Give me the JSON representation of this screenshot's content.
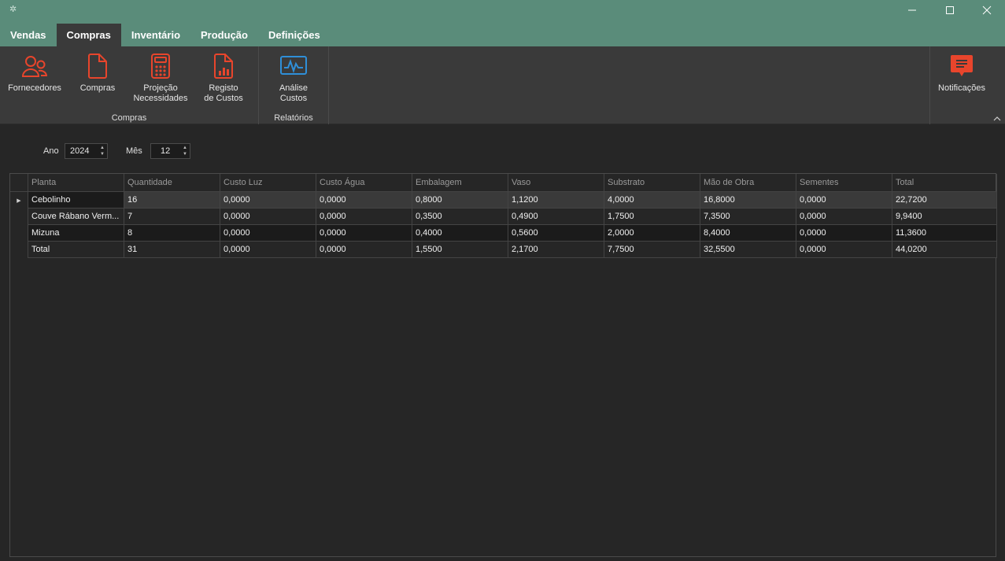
{
  "window": {
    "tabs": [
      {
        "label": "Vendas"
      },
      {
        "label": "Compras"
      },
      {
        "label": "Inventário"
      },
      {
        "label": "Produção"
      },
      {
        "label": "Definições"
      }
    ],
    "active_tab": "Compras"
  },
  "ribbon": {
    "groups": [
      {
        "label": "Compras",
        "buttons": [
          {
            "label": "Fornecedores",
            "icon": "suppliers-icon"
          },
          {
            "label": "Compras",
            "icon": "document-icon"
          },
          {
            "label": "Projeção\nNecessidades",
            "icon": "calculator-icon"
          },
          {
            "label": "Registo\nde Custos",
            "icon": "report-chart-icon"
          }
        ]
      },
      {
        "label": "Relatórios",
        "buttons": [
          {
            "label": "Análise\nCustos",
            "icon": "analytics-icon"
          }
        ]
      }
    ],
    "notifications": {
      "label": "Notificações",
      "icon": "notification-icon"
    },
    "accent_color": "#e8452c",
    "analytics_color": "#2f8fd8"
  },
  "filters": {
    "year": {
      "label": "Ano",
      "value": "2024"
    },
    "month": {
      "label": "Mês",
      "value": "12"
    }
  },
  "grid": {
    "columns": [
      "Planta",
      "Quantidade",
      "Custo Luz",
      "Custo Água",
      "Embalagem",
      "Vaso",
      "Substrato",
      "Mão de Obra",
      "Sementes",
      "Total"
    ],
    "rows": [
      [
        "Cebolinho",
        "16",
        "0,0000",
        "0,0000",
        "0,8000",
        "1,1200",
        "4,0000",
        "16,8000",
        "0,0000",
        "22,7200"
      ],
      [
        "Couve Rábano Verm...",
        "7",
        "0,0000",
        "0,0000",
        "0,3500",
        "0,4900",
        "1,7500",
        "7,3500",
        "0,0000",
        "9,9400"
      ],
      [
        "Mizuna",
        "8",
        "0,0000",
        "0,0000",
        "0,4000",
        "0,5600",
        "2,0000",
        "8,4000",
        "0,0000",
        "11,3600"
      ],
      [
        "Total",
        "31",
        "0,0000",
        "0,0000",
        "1,5500",
        "2,1700",
        "7,7500",
        "32,5500",
        "0,0000",
        "44,0200"
      ]
    ],
    "selected_row": 0
  },
  "colors": {
    "titlebar": "#5a8c7a",
    "ribbon": "#3a3a3a",
    "background": "#262626"
  }
}
